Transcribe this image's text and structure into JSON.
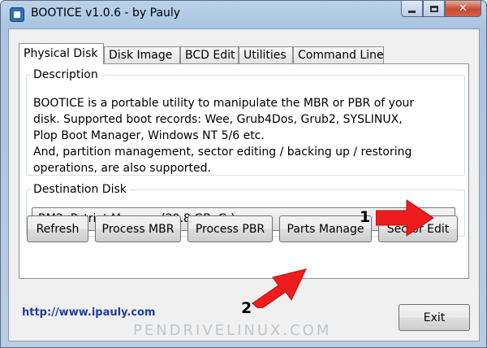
{
  "window": {
    "title": "BOOTICE v1.0.6 - by Pauly",
    "controls": [
      "minimize",
      "maximize",
      "close"
    ]
  },
  "tabs": [
    {
      "label": "Physical Disk",
      "active": true
    },
    {
      "label": "Disk Image",
      "active": false
    },
    {
      "label": "BCD Edit",
      "active": false
    },
    {
      "label": "Utilities",
      "active": false
    },
    {
      "label": "Command Line",
      "active": false
    }
  ],
  "description": {
    "legend": "Description",
    "line1": "BOOTICE is a portable utility to manipulate the MBR or PBR of your",
    "line2": "disk. Supported boot records: Wee, Grub4Dos, Grub2, SYSLINUX,",
    "line3": "Plop Boot Manager, Windows NT 5/6 etc.",
    "line4": "And, partition management, sector editing / backing up / restoring",
    "line5": "operations, are also supported."
  },
  "destination": {
    "legend": "Destination Disk",
    "selected": "RM2:  Patriot Memory (29.8 GB, G:)"
  },
  "buttons": {
    "refresh": "Refresh",
    "process_mbr": "Process MBR",
    "process_pbr": "Process PBR",
    "parts_manage": "Parts Manage",
    "sector_edit": "Sector Edit",
    "exit": "Exit"
  },
  "link": "http://www.ipauly.com",
  "annotations": {
    "marker1": "1",
    "marker2": "2",
    "arrow_color": "#ee1c1c"
  },
  "watermark": "PENDRIVELINUX.COM",
  "icons": {
    "app": "bootice-app-icon",
    "dropdown": "chevron-down-icon"
  }
}
